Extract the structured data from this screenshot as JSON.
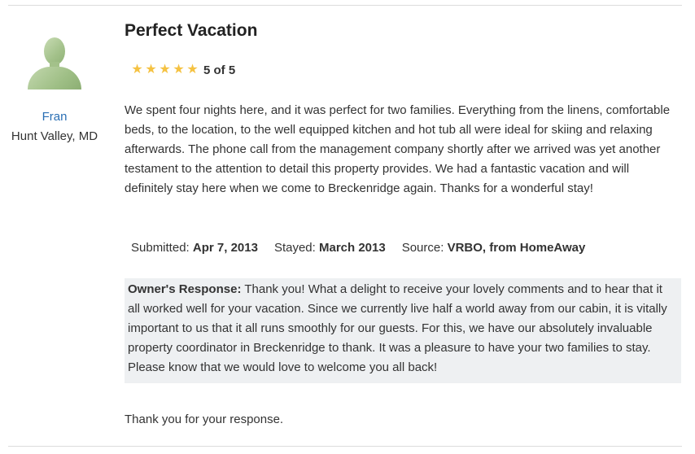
{
  "reviewer": {
    "name": "Fran",
    "location": "Hunt Valley, MD"
  },
  "review": {
    "title": "Perfect Vacation",
    "rating": {
      "value": 5,
      "max": 5,
      "text": "5 of 5",
      "star_color": "#f5c242"
    },
    "body": "We spent four nights here, and it was perfect for two families. Everything from the linens, comfortable beds, to the location, to the well equipped kitchen and hot tub all were ideal for skiing and relaxing afterwards. The phone call from the management company shortly after we arrived was yet another testament to the attention to detail this property provides. We had a fantastic vacation and will definitely stay here when we come to Breckenridge again. Thanks for a wonderful stay!",
    "meta": {
      "submitted_label": "Submitted:",
      "submitted_value": "Apr 7, 2013",
      "stayed_label": "Stayed:",
      "stayed_value": "March 2013",
      "source_label": "Source:",
      "source_value": "VRBO, from HomeAway"
    },
    "owner_response": {
      "label": "Owner's Response:",
      "text": "Thank you! What a delight to receive your lovely comments and to hear that it all worked well for your vacation. Since we currently live half a world away from our cabin, it is vitally important to us that it all runs smoothly for our guests. For this, we have our absolutely invaluable property coordinator in Breckenridge to thank. It was a pleasure to have your two families to stay. Please know that we would love to welcome you all back!"
    },
    "reply": "Thank you for your response."
  },
  "colors": {
    "link": "#2a6fb4",
    "response_bg": "#eef0f2",
    "avatar": "#a3c18a"
  }
}
